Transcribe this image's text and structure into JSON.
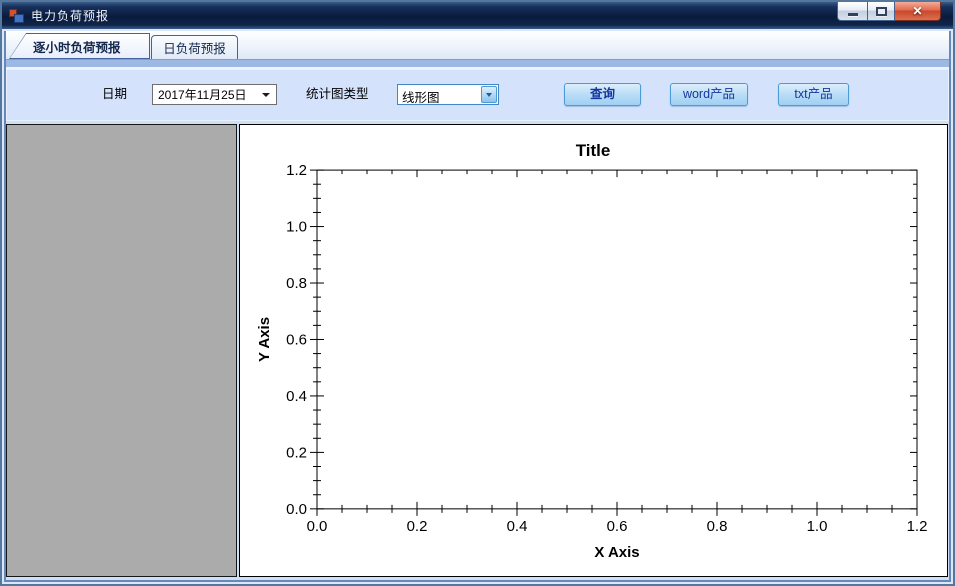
{
  "window": {
    "title": "电力负荷预报",
    "glyphs": {
      "close": "✕"
    }
  },
  "tabs": [
    {
      "label": "逐小时负荷预报",
      "selected": true
    },
    {
      "label": "日负荷预报",
      "selected": false
    }
  ],
  "toolbar": {
    "date_label": "日期",
    "date_value": "2017年11月25日",
    "chart_type_label": "统计图类型",
    "chart_type_value": "线形图",
    "query_button": "查询",
    "word_button": "word产品",
    "txt_button": "txt产品"
  },
  "chart_data": {
    "type": "line",
    "title": "Title",
    "xlabel": "X Axis",
    "ylabel": "Y Axis",
    "xlim": [
      0.0,
      1.2
    ],
    "ylim": [
      0.0,
      1.2
    ],
    "x_ticks": [
      "0.0",
      "0.2",
      "0.4",
      "0.6",
      "0.8",
      "1.0",
      "1.2"
    ],
    "y_ticks": [
      "0.0",
      "0.2",
      "0.4",
      "0.6",
      "0.8",
      "1.0",
      "1.2"
    ],
    "minor_ticks_per_interval": 3,
    "grid": false,
    "legend": false,
    "series": []
  },
  "colors": {
    "titlebar": "#0e2148",
    "accent_strip": "#9db9e3",
    "toolbar_bg": "#d4e3fb",
    "main_bg": "#cfe0f5",
    "panel_gray": "#ababab",
    "button_border": "#4d9bd5",
    "button_text": "#1535a0",
    "close_red": "#c8482c"
  }
}
